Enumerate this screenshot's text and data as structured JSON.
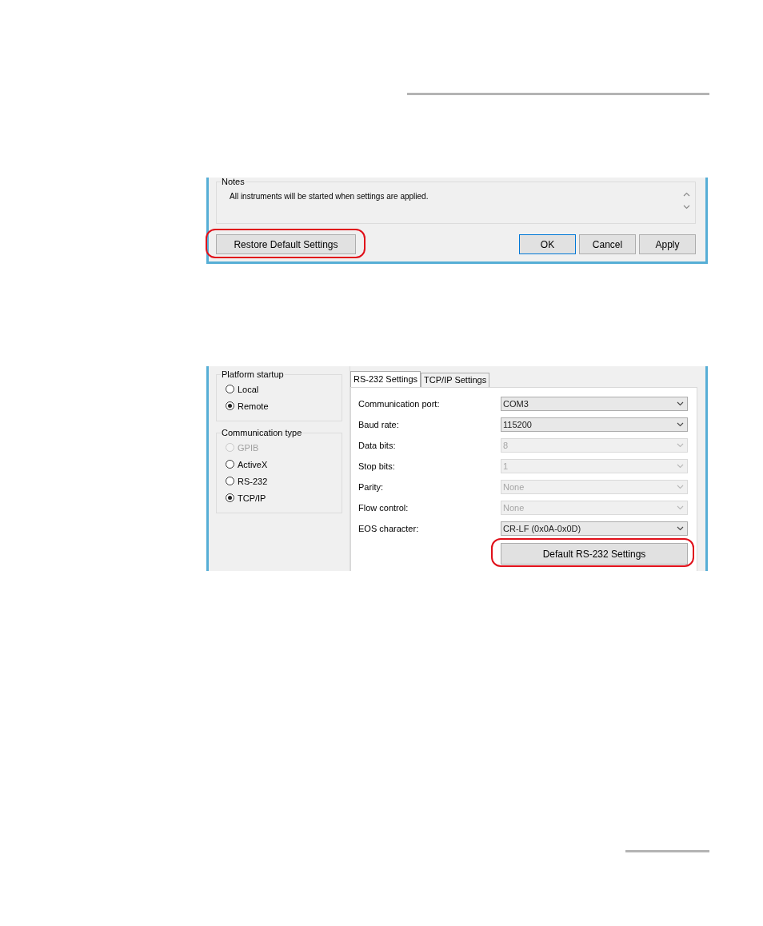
{
  "notes_dialog": {
    "notes": {
      "title": "Notes",
      "text": "All instruments will be started when settings are applied."
    },
    "buttons": [
      {
        "label": "Restore Default Settings",
        "highlighted": true,
        "default": false
      },
      {
        "label": "OK",
        "highlighted": false,
        "default": true
      },
      {
        "label": "Cancel",
        "highlighted": false,
        "default": false
      },
      {
        "label": "Apply",
        "highlighted": false,
        "default": false
      }
    ]
  },
  "connection_dialog": {
    "groups": [
      {
        "title": "Platform startup",
        "options": [
          {
            "label": "Local",
            "selected": false,
            "disabled": false
          },
          {
            "label": "Remote",
            "selected": true,
            "disabled": false
          }
        ]
      },
      {
        "title": "Communication type",
        "options": [
          {
            "label": "GPIB",
            "selected": false,
            "disabled": true
          },
          {
            "label": "ActiveX",
            "selected": false,
            "disabled": false
          },
          {
            "label": "RS-232",
            "selected": false,
            "disabled": false
          },
          {
            "label": "TCP/IP",
            "selected": true,
            "disabled": false
          }
        ]
      }
    ],
    "tabs": [
      {
        "label": "RS-232 Settings",
        "selected": true
      },
      {
        "label": "TCP/IP Settings",
        "selected": false
      }
    ],
    "fields": [
      {
        "label": "Communication port:",
        "value": "COM3",
        "disabled": false
      },
      {
        "label": "Baud rate:",
        "value": "115200",
        "disabled": false
      },
      {
        "label": "Data bits:",
        "value": "8",
        "disabled": true
      },
      {
        "label": "Stop bits:",
        "value": "1",
        "disabled": true
      },
      {
        "label": "Parity:",
        "value": "None",
        "disabled": true
      },
      {
        "label": "Flow control:",
        "value": "None",
        "disabled": true
      },
      {
        "label": "EOS character:",
        "value": "CR-LF (0x0A-0x0D)",
        "disabled": false
      }
    ],
    "reset_button": {
      "label": "Default RS-232 Settings",
      "highlighted": true
    }
  }
}
